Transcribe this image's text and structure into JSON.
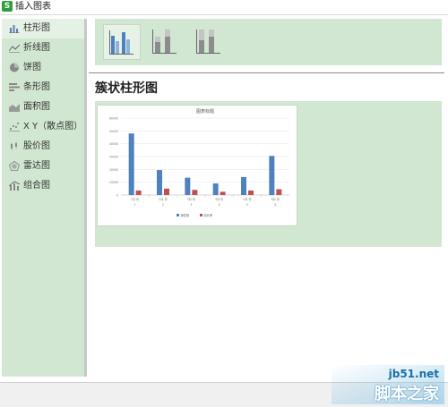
{
  "window": {
    "title": "插入图表",
    "app_icon_letter": "S"
  },
  "sidebar": {
    "items": [
      {
        "label": "柱形图",
        "icon": "column-chart-icon",
        "active": true
      },
      {
        "label": "折线图",
        "icon": "line-chart-icon"
      },
      {
        "label": "饼图",
        "icon": "pie-chart-icon"
      },
      {
        "label": "条形图",
        "icon": "bar-chart-icon"
      },
      {
        "label": "面积图",
        "icon": "area-chart-icon"
      },
      {
        "label": "X Y（散点图）",
        "icon": "scatter-chart-icon"
      },
      {
        "label": "股价图",
        "icon": "stock-chart-icon"
      },
      {
        "label": "雷达图",
        "icon": "radar-chart-icon"
      },
      {
        "label": "组合图",
        "icon": "combo-chart-icon"
      }
    ]
  },
  "subtypes": [
    {
      "name": "clustered-column",
      "selected": true
    },
    {
      "name": "stacked-column"
    },
    {
      "name": "percent-stacked-column"
    }
  ],
  "main": {
    "heading": "簇状柱形图"
  },
  "colors": {
    "series_blue": "#4f81bd",
    "series_red": "#c0504d",
    "panel_green": "#d2e7d2"
  },
  "chart_data": {
    "type": "bar",
    "title": "图表标题",
    "categories": [
      "1月 份\n1",
      "2月 份\n2",
      "3月 份\n3",
      "4月 份\n4",
      "5月 份\n5",
      "6月 份\n6"
    ],
    "series": [
      {
        "name": "销售额",
        "values": [
          48000,
          19500,
          13500,
          9000,
          14000,
          30500
        ]
      },
      {
        "name": "增长率",
        "values": [
          3500,
          5000,
          4000,
          2500,
          3500,
          4500
        ]
      }
    ],
    "ylim": [
      0,
      60000
    ],
    "yticks": [
      "0",
      "10000",
      "20000",
      "30000",
      "40000",
      "50000",
      "60000"
    ],
    "grid": true,
    "legend_position": "bottom"
  },
  "watermark": {
    "url": "jb51.net",
    "name": "脚本之家"
  }
}
